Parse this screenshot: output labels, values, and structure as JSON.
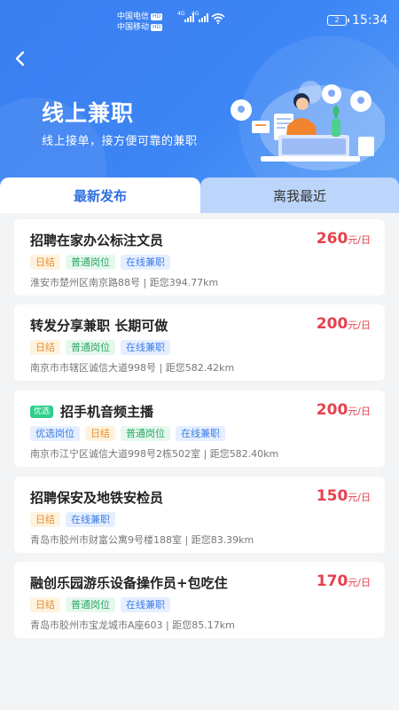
{
  "status": {
    "carrier1": "中国电信",
    "carrier2": "中国移动",
    "hd": "HD",
    "network": "4G",
    "battery": "2",
    "time": "15:34"
  },
  "header": {
    "title": "线上兼职",
    "subtitle": "线上接单，接方便可靠的兼职",
    "back_icon": "chevron-left-icon",
    "gradient_start": "#3a7df0",
    "gradient_end": "#5aa0f7"
  },
  "tabs": [
    {
      "label": "最新发布",
      "active": true
    },
    {
      "label": "离我最近",
      "active": false
    }
  ],
  "colors": {
    "salary": "#e5414d",
    "tag_orange": "#e8902b",
    "tag_green": "#2aa865",
    "tag_blue": "#3d7ce8",
    "badge_green": "#2ecf8a"
  },
  "jobs": [
    {
      "title": "招聘在家办公标注文员",
      "salary": "260",
      "unit": "元/日",
      "tags": [
        "日结",
        "普通岗位",
        "在线兼职"
      ],
      "address": "淮安市楚州区南京路88号 | 距您394.77km"
    },
    {
      "title": "转发分享兼职 长期可做",
      "salary": "200",
      "unit": "元/日",
      "tags": [
        "日结",
        "普通岗位",
        "在线兼职"
      ],
      "address": "南京市市辖区诚信大道998号 | 距您582.42km"
    },
    {
      "badge": "优选",
      "title": "招手机音频主播",
      "salary": "200",
      "unit": "元/日",
      "tags": [
        "优选岗位",
        "日结",
        "普通岗位",
        "在线兼职"
      ],
      "address": "南京市江宁区诚信大道998号2栋502室 | 距您582.40km"
    },
    {
      "title": "招聘保安及地铁安检员",
      "salary": "150",
      "unit": "元/日",
      "tags": [
        "日结",
        "在线兼职"
      ],
      "address": "青岛市胶州市财富公寓9号楼188室 | 距您83.39km"
    },
    {
      "title": "融创乐园游乐设备操作员+包吃住",
      "salary": "170",
      "unit": "元/日",
      "tags": [
        "日结",
        "普通岗位",
        "在线兼职"
      ],
      "address": "青岛市胶州市宝龙城市A座603 | 距您85.17km"
    }
  ]
}
